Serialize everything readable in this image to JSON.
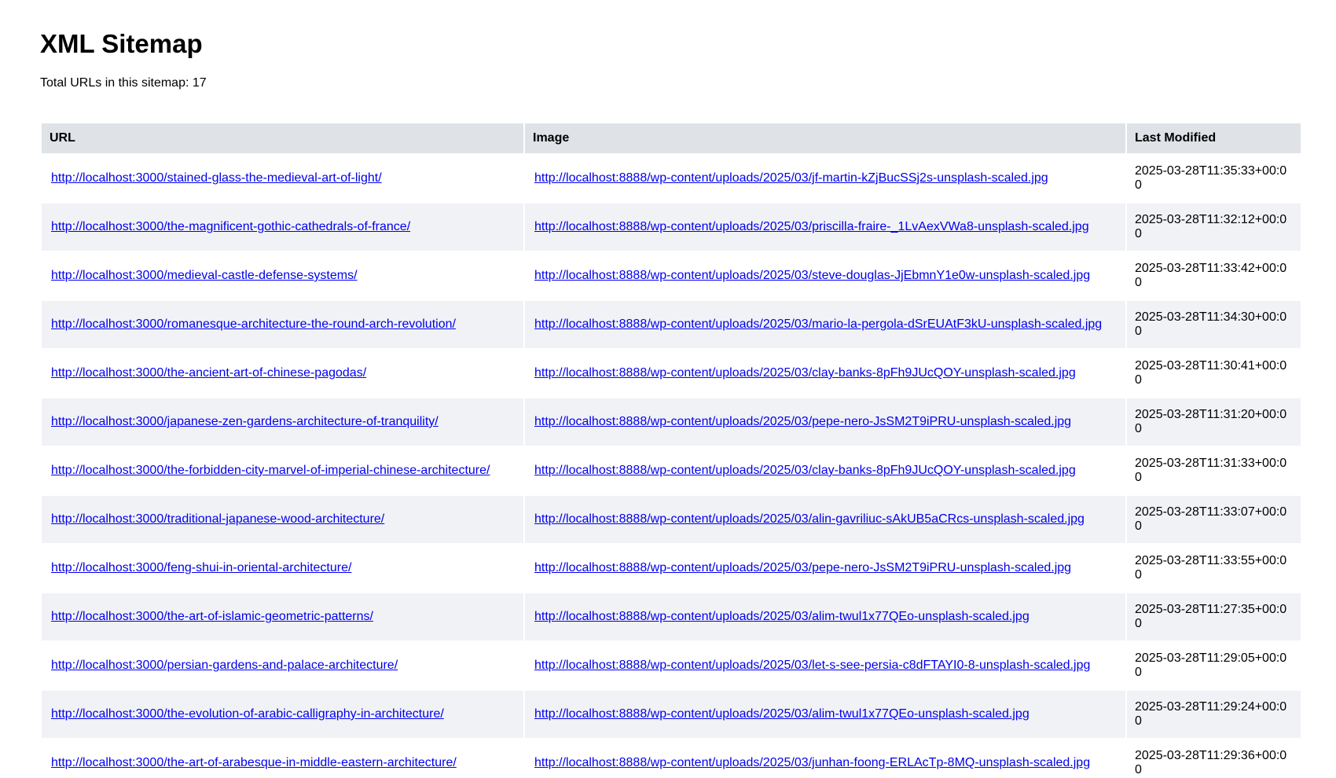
{
  "header": {
    "title": "XML Sitemap",
    "count_text": "Total URLs in this sitemap: 17"
  },
  "table": {
    "columns": [
      "URL",
      "Image",
      "Last Modified"
    ],
    "rows": [
      {
        "url": "http://localhost:3000/stained-glass-the-medieval-art-of-light/",
        "image": "http://localhost:8888/wp-content/uploads/2025/03/jf-martin-kZjBucSSj2s-unsplash-scaled.jpg",
        "modified": "2025-03-28T11:35:33+00:00"
      },
      {
        "url": "http://localhost:3000/the-magnificent-gothic-cathedrals-of-france/",
        "image": "http://localhost:8888/wp-content/uploads/2025/03/priscilla-fraire-_1LvAexVWa8-unsplash-scaled.jpg",
        "modified": "2025-03-28T11:32:12+00:00"
      },
      {
        "url": "http://localhost:3000/medieval-castle-defense-systems/",
        "image": "http://localhost:8888/wp-content/uploads/2025/03/steve-douglas-JjEbmnY1e0w-unsplash-scaled.jpg",
        "modified": "2025-03-28T11:33:42+00:00"
      },
      {
        "url": "http://localhost:3000/romanesque-architecture-the-round-arch-revolution/",
        "image": "http://localhost:8888/wp-content/uploads/2025/03/mario-la-pergola-dSrEUAtF3kU-unsplash-scaled.jpg",
        "modified": "2025-03-28T11:34:30+00:00"
      },
      {
        "url": "http://localhost:3000/the-ancient-art-of-chinese-pagodas/",
        "image": "http://localhost:8888/wp-content/uploads/2025/03/clay-banks-8pFh9JUcQOY-unsplash-scaled.jpg",
        "modified": "2025-03-28T11:30:41+00:00"
      },
      {
        "url": "http://localhost:3000/japanese-zen-gardens-architecture-of-tranquility/",
        "image": "http://localhost:8888/wp-content/uploads/2025/03/pepe-nero-JsSM2T9iPRU-unsplash-scaled.jpg",
        "modified": "2025-03-28T11:31:20+00:00"
      },
      {
        "url": "http://localhost:3000/the-forbidden-city-marvel-of-imperial-chinese-architecture/",
        "image": "http://localhost:8888/wp-content/uploads/2025/03/clay-banks-8pFh9JUcQOY-unsplash-scaled.jpg",
        "modified": "2025-03-28T11:31:33+00:00"
      },
      {
        "url": "http://localhost:3000/traditional-japanese-wood-architecture/",
        "image": "http://localhost:8888/wp-content/uploads/2025/03/alin-gavriliuc-sAkUB5aCRcs-unsplash-scaled.jpg",
        "modified": "2025-03-28T11:33:07+00:00"
      },
      {
        "url": "http://localhost:3000/feng-shui-in-oriental-architecture/",
        "image": "http://localhost:8888/wp-content/uploads/2025/03/pepe-nero-JsSM2T9iPRU-unsplash-scaled.jpg",
        "modified": "2025-03-28T11:33:55+00:00"
      },
      {
        "url": "http://localhost:3000/the-art-of-islamic-geometric-patterns/",
        "image": "http://localhost:8888/wp-content/uploads/2025/03/alim-twul1x77QEo-unsplash-scaled.jpg",
        "modified": "2025-03-28T11:27:35+00:00"
      },
      {
        "url": "http://localhost:3000/persian-gardens-and-palace-architecture/",
        "image": "http://localhost:8888/wp-content/uploads/2025/03/let-s-see-persia-c8dFTAYI0-8-unsplash-scaled.jpg",
        "modified": "2025-03-28T11:29:05+00:00"
      },
      {
        "url": "http://localhost:3000/the-evolution-of-arabic-calligraphy-in-architecture/",
        "image": "http://localhost:8888/wp-content/uploads/2025/03/alim-twul1x77QEo-unsplash-scaled.jpg",
        "modified": "2025-03-28T11:29:24+00:00"
      },
      {
        "url": "http://localhost:3000/the-art-of-arabesque-in-middle-eastern-architecture/",
        "image": "http://localhost:8888/wp-content/uploads/2025/03/junhan-foong-ERLAcTp-8MQ-unsplash-scaled.jpg",
        "modified": "2025-03-28T11:29:36+00:00"
      }
    ]
  },
  "colors": {
    "link": "#0000ee",
    "header_bg": "#dfe2e6",
    "row_alt_bg": "#f1f2f5"
  }
}
